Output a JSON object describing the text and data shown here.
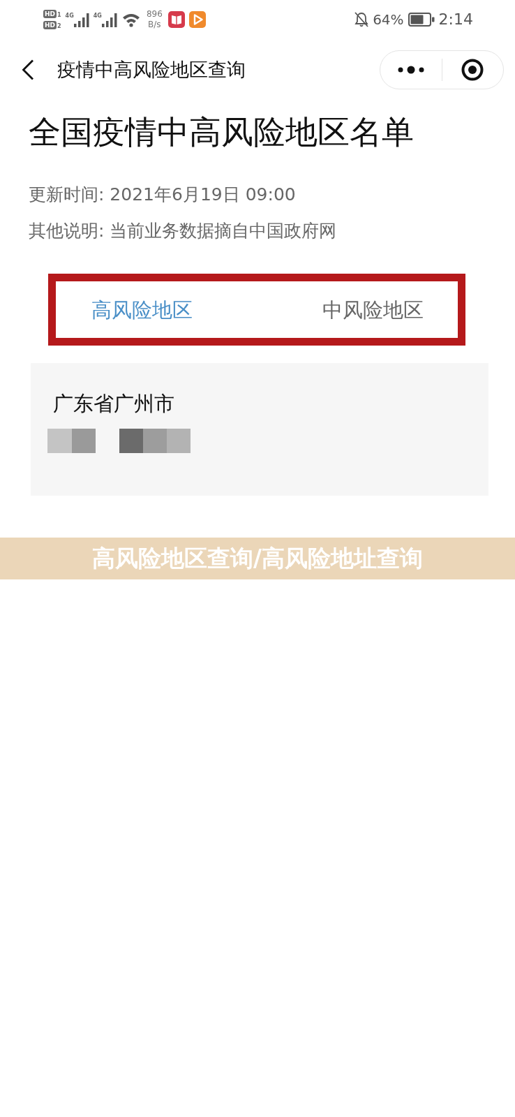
{
  "status_bar": {
    "sim_badges": [
      {
        "label": "HD",
        "slot": "1"
      },
      {
        "label": "HD",
        "slot": "2"
      }
    ],
    "signals": [
      {
        "network": "4G"
      },
      {
        "network": "4G"
      }
    ],
    "net_speed": {
      "value": "896",
      "unit": "B/s"
    },
    "battery_percent": "64%",
    "time": "2:14"
  },
  "nav_bar": {
    "title": "疫情中高风险地区查询"
  },
  "page": {
    "title": "全国疫情中高风险地区名单",
    "info": [
      "更新时间: 2021年6月19日 09:00",
      "其他说明: 当前业务数据摘自中国政府网"
    ]
  },
  "tabs": [
    {
      "label": "高风险地区",
      "selected": true
    },
    {
      "label": "中风险地区",
      "selected": false
    }
  ],
  "areas": [
    {
      "name": "广东省广州市"
    }
  ],
  "caption_banner": {
    "text": "高风险地区查询/高风险地址查询"
  }
}
